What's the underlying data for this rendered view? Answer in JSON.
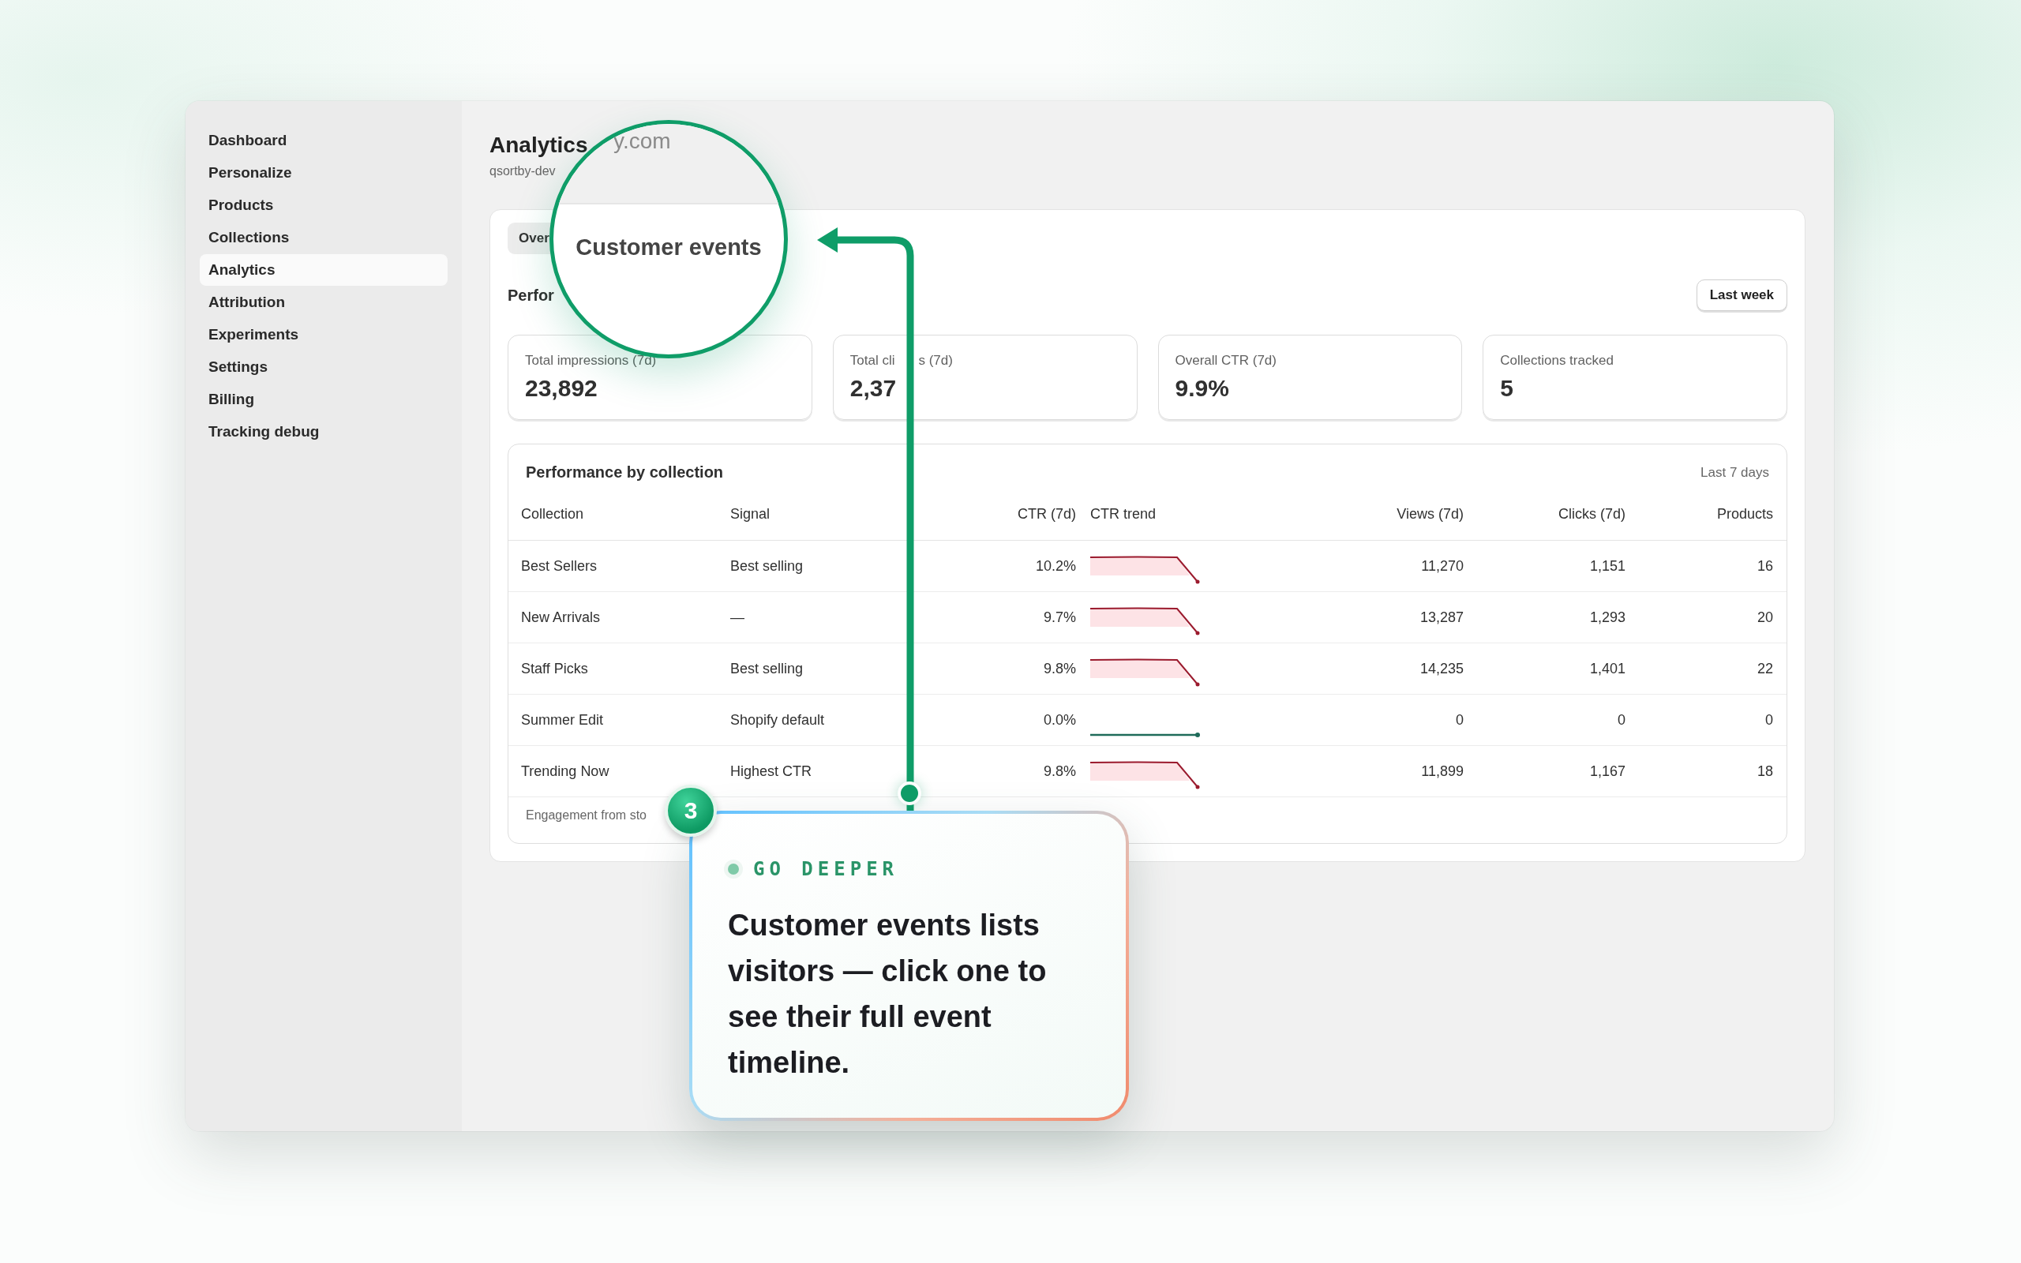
{
  "sidebar": {
    "items": [
      {
        "label": "Dashboard",
        "selected": false
      },
      {
        "label": "Personalize",
        "selected": false
      },
      {
        "label": "Products",
        "selected": false
      },
      {
        "label": "Collections",
        "selected": false
      },
      {
        "label": "Analytics",
        "selected": true
      },
      {
        "label": "Attribution",
        "selected": false
      },
      {
        "label": "Experiments",
        "selected": false
      },
      {
        "label": "Settings",
        "selected": false
      },
      {
        "label": "Billing",
        "selected": false
      },
      {
        "label": "Tracking debug",
        "selected": false
      }
    ]
  },
  "header": {
    "title": "Analytics",
    "subtitle": "qsortby-dev"
  },
  "tabs": [
    {
      "label": "Over",
      "selected": true
    }
  ],
  "section": {
    "title": "Perfor",
    "range_button": "Last week"
  },
  "stats": [
    {
      "label": "Total impressions (7d)",
      "value": "23,892"
    },
    {
      "label": "Total cli",
      "label_rest": "s (7d)",
      "value": "2,37"
    },
    {
      "label": "Overall CTR (7d)",
      "value": "9.9%"
    },
    {
      "label": "Collections tracked",
      "value": "5"
    }
  ],
  "table": {
    "title": "Performance by collection",
    "range": "Last 7 days",
    "columns": [
      "Collection",
      "Signal",
      "CTR (7d)",
      "CTR trend",
      "Views (7d)",
      "Clicks (7d)",
      "Products"
    ],
    "rows": [
      {
        "collection": "Best Sellers",
        "signal": "Best selling",
        "ctr": "10.2%",
        "kind": "falling",
        "views": "11,270",
        "clicks": "1,151",
        "products": "16"
      },
      {
        "collection": "New Arrivals",
        "signal": "—",
        "ctr": "9.7%",
        "kind": "falling",
        "views": "13,287",
        "clicks": "1,293",
        "products": "20"
      },
      {
        "collection": "Staff Picks",
        "signal": "Best selling",
        "ctr": "9.8%",
        "kind": "falling",
        "views": "14,235",
        "clicks": "1,401",
        "products": "22"
      },
      {
        "collection": "Summer Edit",
        "signal": "Shopify default",
        "ctr": "0.0%",
        "kind": "flat",
        "views": "0",
        "clicks": "0",
        "products": "0"
      },
      {
        "collection": "Trending Now",
        "signal": "Highest CTR",
        "ctr": "9.8%",
        "kind": "falling",
        "views": "11,899",
        "clicks": "1,167",
        "products": "18"
      }
    ],
    "footer": "Engagement from sto"
  },
  "magnifier": {
    "domain": "y.com",
    "label": "Customer events"
  },
  "callout": {
    "step": "3",
    "eyebrow": "GO DEEPER",
    "text": "Customer events lists visitors — click one to see their full event timeline."
  }
}
